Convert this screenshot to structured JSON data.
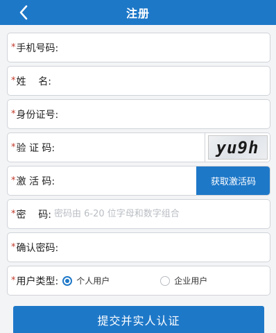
{
  "header": {
    "title": "注册",
    "back_icon": "chevron-left-icon"
  },
  "form": {
    "required_mark": "*",
    "phone": {
      "label": "手机号码:",
      "value": "",
      "placeholder": ""
    },
    "name": {
      "label": "姓    名:",
      "value": "",
      "placeholder": ""
    },
    "id_number": {
      "label": "身份证号:",
      "value": "",
      "placeholder": ""
    },
    "captcha": {
      "label": "验 证 码:",
      "value": "",
      "placeholder": "",
      "image_text": "yu9h"
    },
    "activation": {
      "label": "激 活 码:",
      "value": "",
      "placeholder": "",
      "button_label": "获取激活码"
    },
    "password": {
      "label": "密    码:",
      "value": "",
      "placeholder": "密码由 6-20 位字母和数字组合"
    },
    "confirm_password": {
      "label": "确认密码:",
      "value": "",
      "placeholder": ""
    },
    "user_type": {
      "label": "用户类型:",
      "options": [
        {
          "label": "个人用户",
          "checked": true
        },
        {
          "label": "企业用户",
          "checked": false
        }
      ]
    }
  },
  "submit": {
    "label": "提交并实人认证"
  },
  "colors": {
    "primary": "#1e78c8",
    "required": "#c0392b",
    "border": "#cfd3d8",
    "background": "#f3f4f6"
  }
}
